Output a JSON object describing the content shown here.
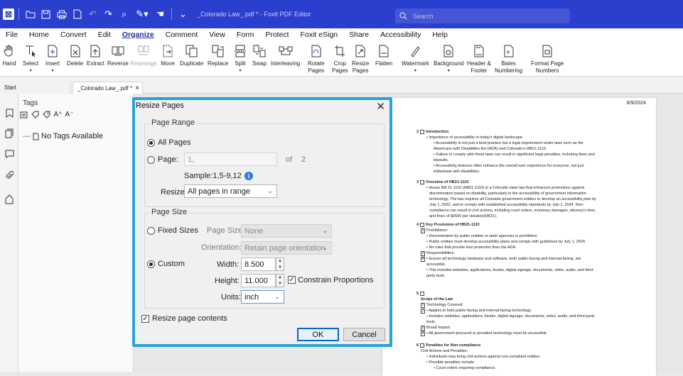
{
  "app": {
    "doc_title": "_Colorado Law_.pdf * - Foxit PDF Editor",
    "search_placeholder": "Search"
  },
  "menu": [
    "File",
    "Home",
    "Convert",
    "Edit",
    "Organize",
    "Comment",
    "View",
    "Form",
    "Protect",
    "Foxit eSign",
    "Share",
    "Accessibility",
    "Help"
  ],
  "ribbon": {
    "hand": "Hand",
    "select": "Select",
    "insert": "Insert",
    "delete": "Delete",
    "extract": "Extract",
    "reverse": "Reverse",
    "rearrange": "Rearrange",
    "move": "Move",
    "duplicate": "Duplicate",
    "replace": "Replace",
    "split": "Split",
    "swap": "Swap",
    "interleaving": "Interleaving",
    "rotate1": "Rotate",
    "rotate2": "Pages",
    "crop1": "Crop",
    "crop2": "Pages",
    "resize1": "Resize",
    "resize2": "Pages",
    "flatten": "Flatten",
    "watermark": "Watermark",
    "background": "Background",
    "hf1": "Header &",
    "hf2": "Footer",
    "bates1": "Bates",
    "bates2": "Numbering",
    "fpn1": "Format Page",
    "fpn2": "Numbers"
  },
  "tabs": {
    "start": "Start",
    "doc": "_Colorado Law_.pdf *",
    "close": "×"
  },
  "panel": {
    "title": "Tags",
    "empty": "No Tags Available"
  },
  "dialog": {
    "title": "Resize Pages",
    "close": "✕",
    "page_range": {
      "legend": "Page Range",
      "all_pages": "All Pages",
      "page": "Page:",
      "page_value": "1,",
      "of": "of",
      "total": "2",
      "sample": "Sample:1,5-9,12",
      "resize_label": "Resize:",
      "resize_value": "All pages in range"
    },
    "page_size": {
      "legend": "Page Size",
      "fixed_sizes": "Fixed Sizes",
      "page_size_label": "Page Size:",
      "page_size_value": "None",
      "orientation_label": "Orientation:",
      "orientation_value": "Retain page orientation",
      "custom": "Custom",
      "width_label": "Width:",
      "width_value": "8.500",
      "height_label": "Height:",
      "height_value": "11.000",
      "constrain": "Constrain Proportions",
      "units_label": "Units:",
      "units_value": "inch"
    },
    "resize_contents": "Resize page contents",
    "ok": "OK",
    "cancel": "Cancel"
  },
  "document": {
    "date": "8/9/2024",
    "s2_num": "2",
    "s2_title": "Introduction",
    "s2_l1": "• Importance of accessibility in today's digital landscape.",
    "s2_l2": "• Accessibility is not just a best practice but a legal requirement under laws such as the",
    "s2_l3": "Americans with Disabilities Act (ADA) and Colorado's HB21-1110.",
    "s2_l4": "• Failure to comply with these laws can result in significant legal penalties, including fines and",
    "s2_l5": "lawsuits.",
    "s2_l6": "• Accessibility features often enhance the overall user experience for everyone, not just",
    "s2_l7": "individuals with disabilities.",
    "s3_num": "3",
    "s3_title": "Overview of HB21-1110",
    "s3_l1": "• House Bill 21-1110 (HB21-1110) is a Colorado state law that enhances protections against",
    "s3_l2": "discrimination based on disability, particularly in the accessibility of government information",
    "s3_l3": "technology. The law requires all Colorado government entities to develop an accessibility plan by",
    "s3_l4": "July 1, 2022, and to comply with established accessibility standards by July 1, 2024. Non-",
    "s3_l5": "compliance can result in civil actions, including court orders, monetary damages, attorney's fees,",
    "s3_l6": "and fines of $3500 per violation(HB21).",
    "s4_num": "4",
    "s4_title": "Key Provisions of HB21-1110",
    "s4_n1": "1",
    "s4_l1": "Prohibitions:",
    "s4_l2": "• Discrimination by public entities or state agencies is prohibited.",
    "s4_l3": "• Public entities must develop accessibility plans and comply with guidelines by July 1, 2024.",
    "s4_l4": "• No rules that provide less protection than the ADA.",
    "s4_n2": "3",
    "s4_l5": "Responsibilities:",
    "s4_n3": "4",
    "s4_l6": "• Ensure all technology hardware and software, both public-facing and internal-facing, are",
    "s4_l7": "accessible.",
    "s4_l8": "• This includes websites, applications, kiosks, digital signage, documents, video, audio, and third-",
    "s4_l9": "party tools",
    "s5_num": "5",
    "s5_title": "Scope of the Law",
    "s5_n1": "1",
    "s5_l1": "Technology Covered:",
    "s5_n2": "2",
    "s5_l2": "• Applies to both public-facing and internal-facing technology.",
    "s5_l3": "• Includes websites, applications, kiosks, digital signage, documents, video, audio, and third-party",
    "s5_l4": "tools.",
    "s5_n3": "3",
    "s5_l5": "Broad Impact:",
    "s5_n4": "4",
    "s5_l6": "• All government-procured or provided technology must be accessible.",
    "s6_num": "6",
    "s6_title": "Penalties for Non-compliance",
    "s6_l1": "Civil Actions and Penalties:",
    "s6_l2": "• Individuals may bring civil actions against non-compliant entities.",
    "s6_l3": "• Possible penalties include:",
    "s6_l4": "• Court orders requiring compliance."
  }
}
